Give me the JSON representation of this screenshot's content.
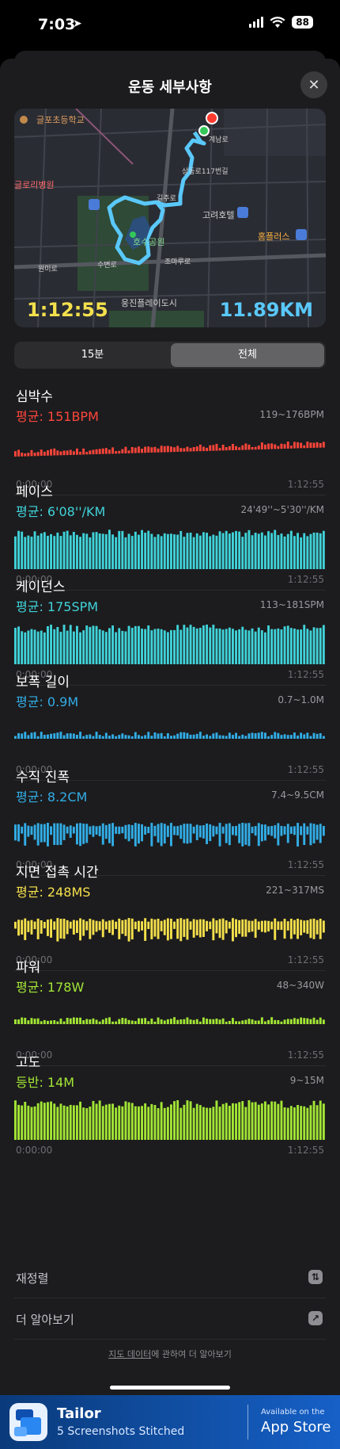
{
  "status": {
    "time": "7:03",
    "battery": "88"
  },
  "sheet": {
    "title": "운동 세부사항"
  },
  "map": {
    "duration": "1:12:55",
    "distance": "11.89KM",
    "labels": [
      "글포초등학교",
      "글로리병원",
      "고려호텔",
      "홈플러스",
      "웅진플레이도시",
      "호수공원",
      "상동로117번길",
      "계남로",
      "길주로",
      "수변로",
      "원미로",
      "조마루로"
    ]
  },
  "segments": {
    "left": "15분",
    "right": "전체",
    "selected": "전체"
  },
  "metrics": [
    {
      "name": "심박수",
      "avg": "평균: 151BPM",
      "range": "119~176BPM",
      "color": "#ff453a",
      "style": "line",
      "start": "0:00:00",
      "end": "1:12:55"
    },
    {
      "name": "페이스",
      "avg": "평균: 6'08''/KM",
      "range": "24'49''~5'30''/KM",
      "color": "#40d3d9",
      "style": "bars",
      "start": "0:00:00",
      "end": "1:12:55"
    },
    {
      "name": "케이던스",
      "avg": "평균: 175SPM",
      "range": "113~181SPM",
      "color": "#40d3d9",
      "style": "bars",
      "start": "0:00:00",
      "end": "1:12:55"
    },
    {
      "name": "보폭 길이",
      "avg": "평균: 0.9M",
      "range": "0.7~1.0M",
      "color": "#32ade6",
      "style": "line",
      "start": "0:00:00",
      "end": "1:12:55"
    },
    {
      "name": "수직 진폭",
      "avg": "평균: 8.2CM",
      "range": "7.4~9.5CM",
      "color": "#32ade6",
      "style": "sticks",
      "start": "0:00:00",
      "end": "1:12:55"
    },
    {
      "name": "지면 접촉 시간",
      "avg": "평균: 248MS",
      "range": "221~317MS",
      "color": "#f5e04b",
      "style": "sticks",
      "start": "0:00:00",
      "end": "1:12:55"
    },
    {
      "name": "파워",
      "avg": "평균: 178W",
      "range": "48~340W",
      "color": "#a3e635",
      "style": "line",
      "start": "0:00:00",
      "end": "1:12:55"
    },
    {
      "name": "고도",
      "avg": "등반: 14M",
      "range": "9~15M",
      "color": "#a3e635",
      "style": "bars",
      "start": "0:00:00",
      "end": "1:12:55"
    }
  ],
  "rows": [
    {
      "label": "재정렬",
      "icon": "⇅"
    },
    {
      "label": "더 알아보기",
      "icon": "↗"
    }
  ],
  "footnote": {
    "link": "지도 데이터",
    "rest": "에 관하여 더 알아보기"
  },
  "banner": {
    "name": "Tailor",
    "sub": "5 Screenshots Stitched",
    "avail": "Available on the",
    "store": "App Store"
  }
}
